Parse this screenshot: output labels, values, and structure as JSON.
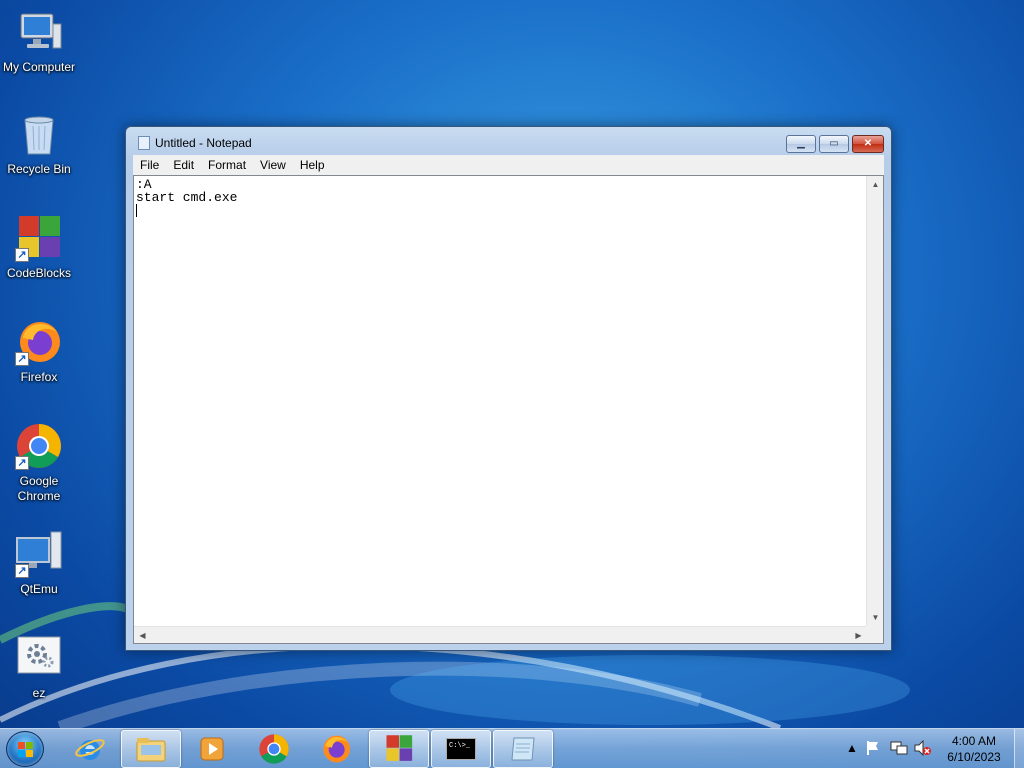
{
  "desktop": {
    "icons": [
      {
        "label": "My Computer",
        "icon": "computer-icon"
      },
      {
        "label": "Recycle Bin",
        "icon": "recycle-bin-icon"
      },
      {
        "label": "CodeBlocks",
        "icon": "codeblocks-icon"
      },
      {
        "label": "Firefox",
        "icon": "firefox-icon"
      },
      {
        "label": "Google Chrome",
        "icon": "chrome-icon"
      },
      {
        "label": "QtEmu",
        "icon": "qtemu-icon"
      },
      {
        "label": "ez",
        "icon": "settings-file-icon"
      }
    ]
  },
  "notepad": {
    "title": "Untitled - Notepad",
    "menu": [
      "File",
      "Edit",
      "Format",
      "View",
      "Help"
    ],
    "lines": [
      ":A",
      "start cmd.exe",
      ""
    ],
    "buttons": {
      "minimize": "▁",
      "maximize": "▭",
      "close": "✕"
    }
  },
  "taskbar": {
    "apps": [
      {
        "name": "internet-explorer",
        "active": false
      },
      {
        "name": "windows-explorer",
        "active": true
      },
      {
        "name": "media-player",
        "active": false
      },
      {
        "name": "chrome",
        "active": false
      },
      {
        "name": "firefox",
        "active": false
      },
      {
        "name": "codeblocks",
        "active": true
      },
      {
        "name": "command-prompt",
        "active": true
      },
      {
        "name": "notepad",
        "active": true
      }
    ],
    "cmd_label": "C:\\>_",
    "tray": {
      "chevron": "▲"
    },
    "clock": {
      "time": "4:00 AM",
      "date": "6/10/2023"
    }
  }
}
